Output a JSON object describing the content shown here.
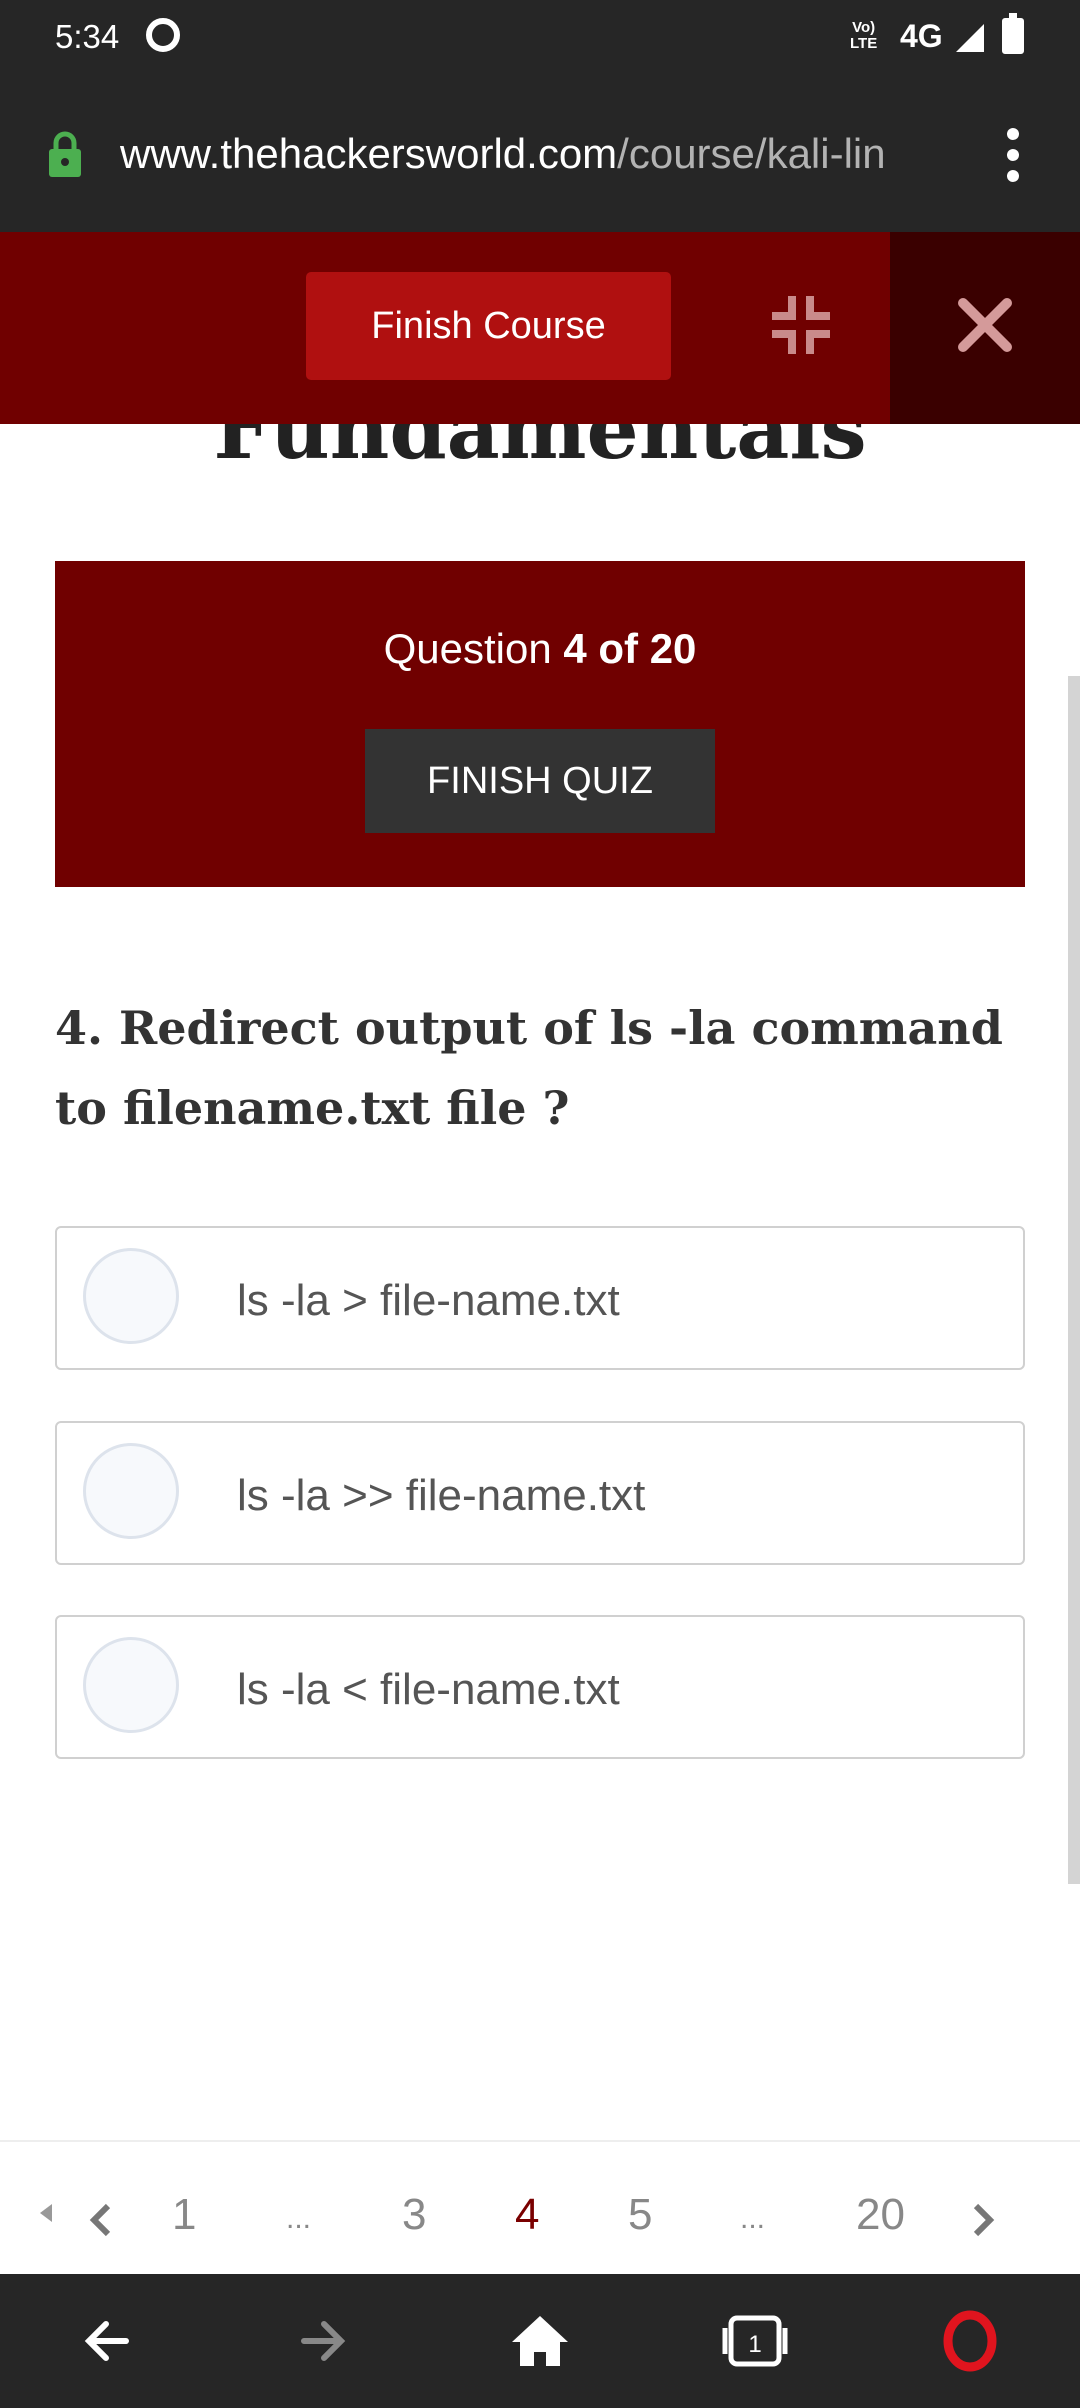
{
  "status_bar": {
    "time": "5:34",
    "volte": "Vo) LTE",
    "network": "4G"
  },
  "browser": {
    "url_domain": "www.thehackersworld.com",
    "url_path": "/course/kali-lin"
  },
  "course_header": {
    "finish_course_label": "Finish Course"
  },
  "page": {
    "title_partial": "Fundamentals"
  },
  "quiz": {
    "counter_prefix": "Question",
    "counter_value": "4 of 20",
    "finish_quiz_label": "FINISH QUIZ",
    "question": "4. Redirect output of ls -la command to filename.txt file ?",
    "answers": [
      {
        "label": "ls -la > file-name.txt"
      },
      {
        "label": "ls -la >> file-name.txt"
      },
      {
        "label": "ls -la < file-name.txt"
      }
    ]
  },
  "pagination": {
    "pages": [
      "1",
      "...",
      "3",
      "4",
      "5",
      "...",
      "20"
    ],
    "current": "4"
  },
  "colors": {
    "primary_dark": "#700000",
    "button_red": "#b01010",
    "close_bg": "#3a0000",
    "active_page": "#7a0000",
    "opera_red": "#e0141e",
    "lock_green": "#4caf50"
  }
}
